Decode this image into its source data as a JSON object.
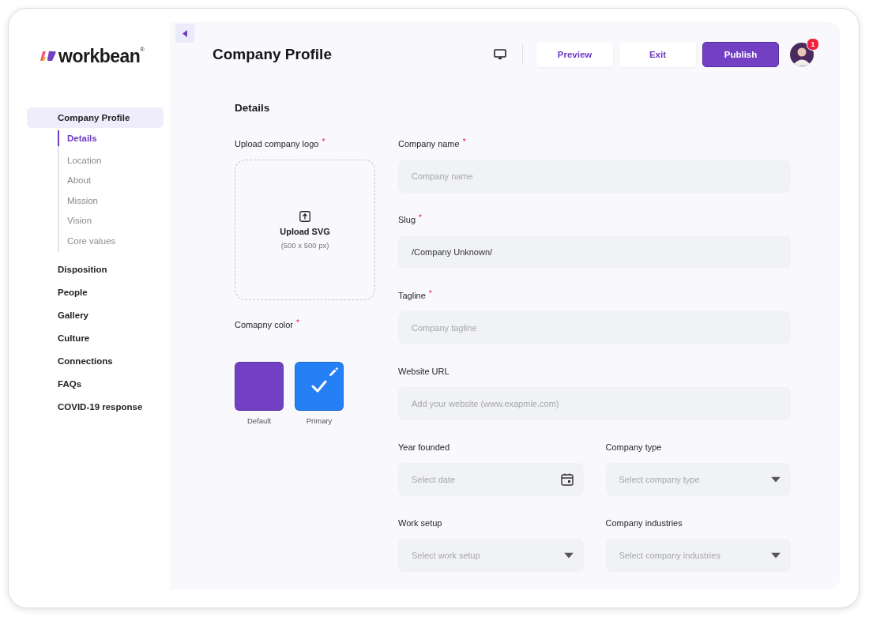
{
  "sidebar": {
    "logo": {
      "wordmark": "workbean$^{®}$"
    },
    "items": [
      {
        "label": "Company Profile",
        "selected": true,
        "children": [
          {
            "label": "Details",
            "selected": true
          },
          {
            "label": "Location",
            "selected": false
          },
          {
            "label": "About",
            "selected": false
          },
          {
            "label": "Mission",
            "selected": false
          },
          {
            "label": "Vision",
            "selected": false
          },
          {
            "label": "Core values",
            "selected": false
          }
        ]
      },
      {
        "label": "Disposition",
        "selected": false
      },
      {
        "label": "People",
        "selected": false
      },
      {
        "label": "Gallery",
        "selected": false
      },
      {
        "label": "Culture",
        "selected": false
      },
      {
        "label": "Connections",
        "selected": false
      },
      {
        "label": "FAQs",
        "selected": false
      },
      {
        "label": "COVID-19 response",
        "selected": false
      }
    ]
  },
  "header": {
    "title": "Company Profile",
    "buttons": [
      {
        "label": "Preview",
        "kind": "secondary"
      },
      {
        "label": "Exit",
        "kind": "secondary"
      },
      {
        "label": "Publish",
        "kind": "primary"
      }
    ],
    "notification_count": "1"
  },
  "form": {
    "section_title": "Details",
    "logo_upload": {
      "label": "Upload company logo",
      "required_mark": "*",
      "title": "Upload SVG",
      "hint": "(500 x 500 px)"
    },
    "color": {
      "label": "Comapny color",
      "required_mark": "*",
      "swatches": [
        {
          "label": "Default",
          "color": "#7340c4",
          "selected": false,
          "editable": false
        },
        {
          "label": "Primary",
          "color": "#2680f5",
          "selected": true,
          "editable": true
        }
      ]
    },
    "rows": [
      [
        {
          "label": "Company name",
          "required_mark": "*",
          "kind": "text",
          "placeholder": "Company name"
        }
      ],
      [
        {
          "label": "Slug",
          "required_mark": "*",
          "kind": "text",
          "value": "/Company Unknown/"
        }
      ],
      [
        {
          "label": "Tagline",
          "required_mark": "*",
          "kind": "text",
          "placeholder": "Company tagline"
        }
      ],
      [
        {
          "label": "Website URL",
          "kind": "text",
          "placeholder": "Add your website (www.exapmle.com)"
        }
      ],
      [
        {
          "label": "Year founded",
          "kind": "date",
          "placeholder": "Select date"
        },
        {
          "label": "Company type",
          "kind": "select",
          "placeholder": "Select company type"
        }
      ],
      [
        {
          "label": "Work setup",
          "kind": "select",
          "placeholder": "Select work setup"
        },
        {
          "label": "Company industries",
          "kind": "select",
          "placeholder": "Select company industries"
        }
      ]
    ]
  }
}
